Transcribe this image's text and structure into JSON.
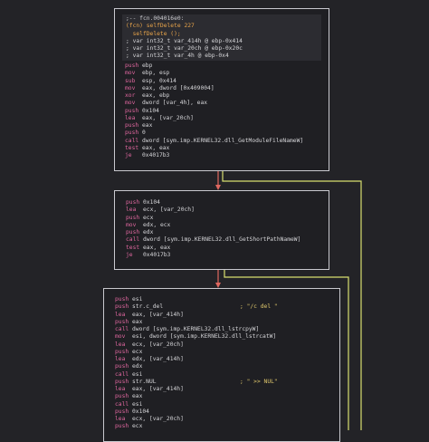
{
  "block1": {
    "header": [
      {
        "text": ";-- fcn.004016e0:",
        "cls": "hl-comment"
      },
      {
        "text": "(fcn) selfDelete 227",
        "cls": "hl-fcn"
      },
      {
        "text": "  selfDelete ();",
        "cls": "hl-fcn"
      },
      {
        "text": "; var int32_t var_414h @ ebp-0x414",
        "cls": "hl-var"
      },
      {
        "text": "; var int32_t var_20ch @ ebp-0x20c",
        "cls": "hl-var"
      },
      {
        "text": "; var int32_t var_4h @ ebp-0x4",
        "cls": "hl-var"
      }
    ],
    "instructions": [
      {
        "mnemonic": "push",
        "operands": "ebp"
      },
      {
        "mnemonic": "mov",
        "operands": "ebp, esp"
      },
      {
        "mnemonic": "sub",
        "operands": "esp, 0x414"
      },
      {
        "mnemonic": "mov",
        "operands": "eax, dword [0x409004]"
      },
      {
        "mnemonic": "xor",
        "operands": "eax, ebp"
      },
      {
        "mnemonic": "mov",
        "operands": "dword [var_4h], eax"
      },
      {
        "mnemonic": "push",
        "operands": "0x104"
      },
      {
        "mnemonic": "lea",
        "operands": "eax, [var_20ch]"
      },
      {
        "mnemonic": "push",
        "operands": "eax"
      },
      {
        "mnemonic": "push",
        "operands": "0"
      },
      {
        "mnemonic": "call",
        "operands": "dword [sym.imp.KERNEL32.dll_GetModuleFileNameW]"
      },
      {
        "mnemonic": "test",
        "operands": "eax, eax"
      },
      {
        "mnemonic": "je",
        "operands": "0x4017b3"
      }
    ]
  },
  "block2": {
    "instructions": [
      {
        "mnemonic": "push",
        "operands": "0x104"
      },
      {
        "mnemonic": "lea",
        "operands": "ecx, [var_20ch]"
      },
      {
        "mnemonic": "push",
        "operands": "ecx"
      },
      {
        "mnemonic": "mov",
        "operands": "edx, ecx"
      },
      {
        "mnemonic": "push",
        "operands": "edx"
      },
      {
        "mnemonic": "call",
        "operands": "dword [sym.imp.KERNEL32.dll_GetShortPathNameW]"
      },
      {
        "mnemonic": "test",
        "operands": "eax, eax"
      },
      {
        "mnemonic": "je",
        "operands": "0x4017b3"
      }
    ]
  },
  "block3": {
    "instructions": [
      {
        "mnemonic": "push",
        "operands": "esi",
        "comment": ""
      },
      {
        "mnemonic": "push",
        "operands": "str.c_del",
        "comment": "; \"/c del \""
      },
      {
        "mnemonic": "lea",
        "operands": "eax, [var_414h]",
        "comment": ""
      },
      {
        "mnemonic": "push",
        "operands": "eax",
        "comment": ""
      },
      {
        "mnemonic": "call",
        "operands": "dword [sym.imp.KERNEL32.dll_lstrcpyW]",
        "comment": ""
      },
      {
        "mnemonic": "mov",
        "operands": "esi, dword [sym.imp.KERNEL32.dll_lstrcatW]",
        "comment": ""
      },
      {
        "mnemonic": "lea",
        "operands": "ecx, [var_20ch]",
        "comment": ""
      },
      {
        "mnemonic": "push",
        "operands": "ecx",
        "comment": ""
      },
      {
        "mnemonic": "lea",
        "operands": "edx, [var_414h]",
        "comment": ""
      },
      {
        "mnemonic": "push",
        "operands": "edx",
        "comment": ""
      },
      {
        "mnemonic": "call",
        "operands": "esi",
        "comment": ""
      },
      {
        "mnemonic": "push",
        "operands": "str.NUL",
        "comment": "; \" >> NUL\""
      },
      {
        "mnemonic": "lea",
        "operands": "eax, [var_414h]",
        "comment": ""
      },
      {
        "mnemonic": "push",
        "operands": "eax",
        "comment": ""
      },
      {
        "mnemonic": "call",
        "operands": "esi",
        "comment": ""
      },
      {
        "mnemonic": "push",
        "operands": "0x104",
        "comment": ""
      },
      {
        "mnemonic": "lea",
        "operands": "ecx, [var_20ch]",
        "comment": ""
      },
      {
        "mnemonic": "push",
        "operands": "ecx",
        "comment": ""
      }
    ]
  },
  "colors": {
    "background": "#232327",
    "node_bg": "#1f1f23",
    "node_border": "#c9c9cf",
    "mnemonic": "#e0679f",
    "operand": "#d5d5d8",
    "comment": "#e0c86c",
    "edge_true": "#e0675f",
    "edge_false": "#d8e070"
  }
}
